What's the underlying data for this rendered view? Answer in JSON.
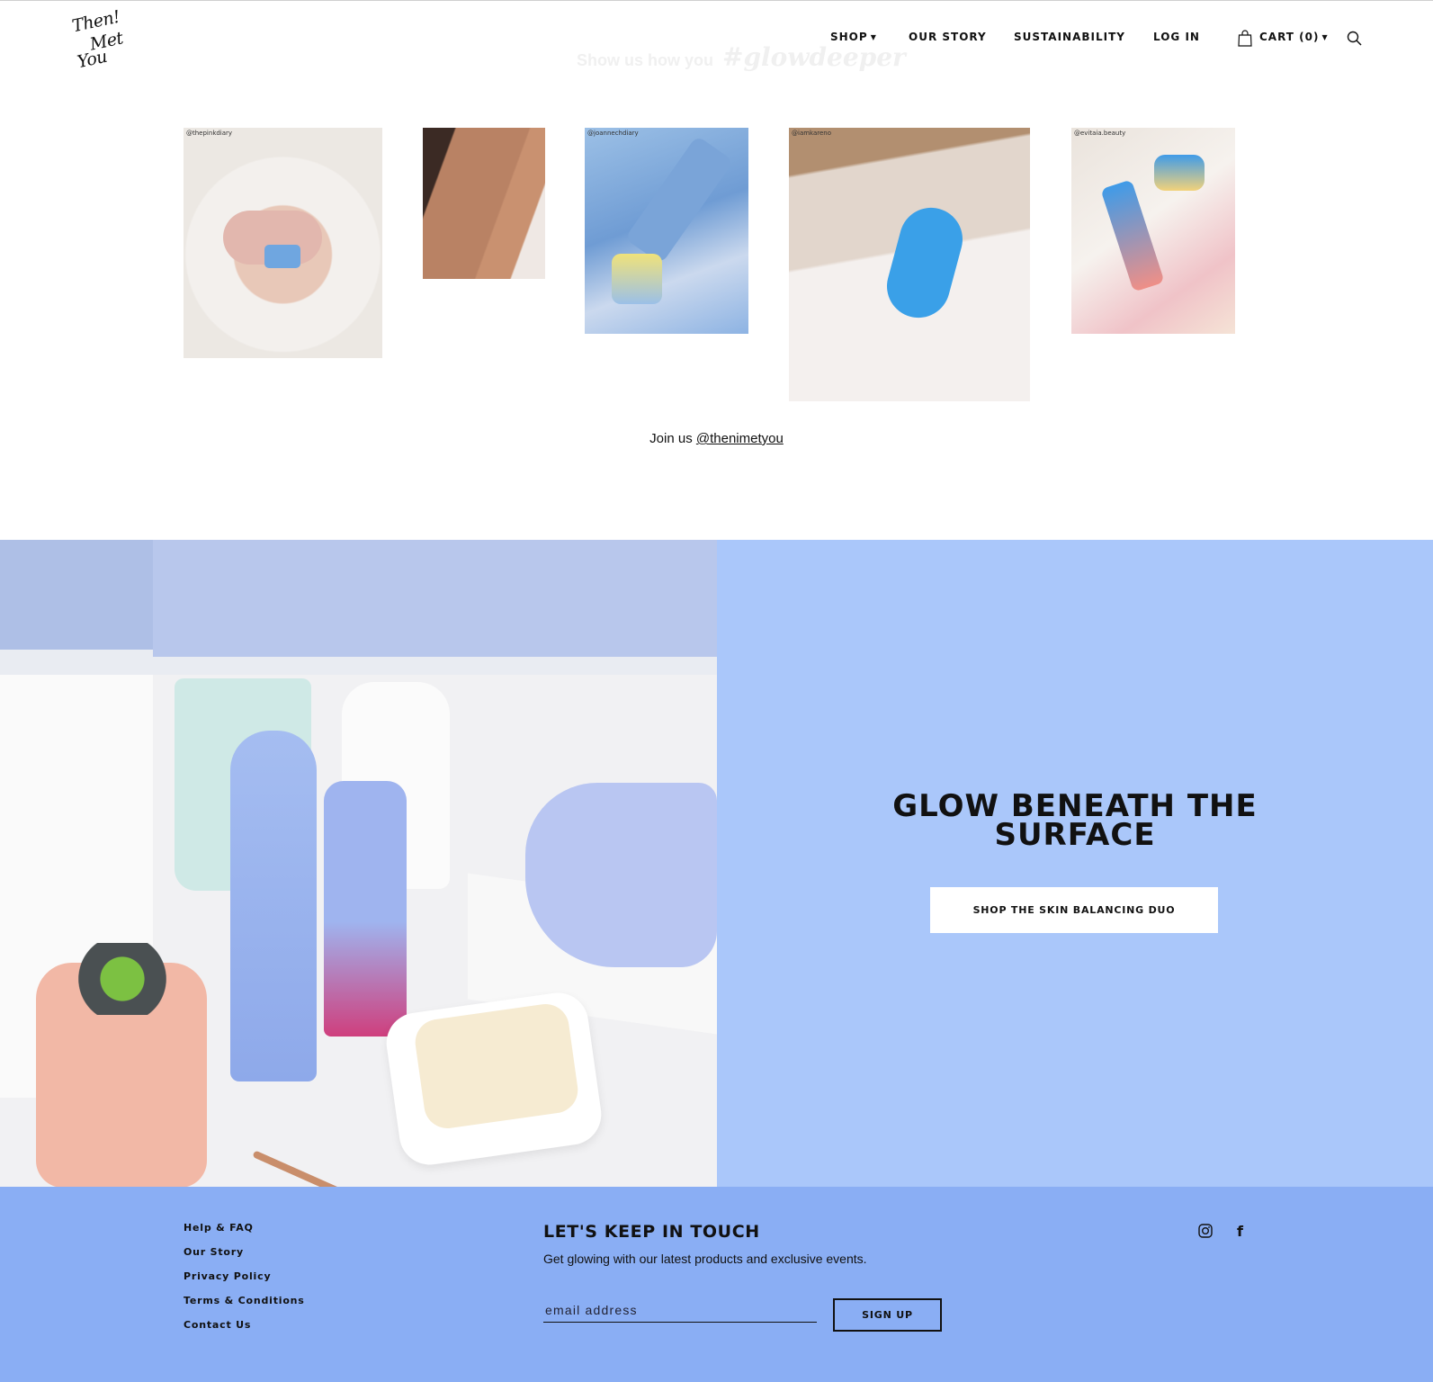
{
  "brand": {
    "logo_lines": [
      "Then!",
      "Met",
      "You"
    ]
  },
  "header": {
    "ghost_prefix": "Show us how you",
    "ghost_hashtag": "#glowdeeper",
    "nav": {
      "shop": "SHOP",
      "our_story": "OUR STORY",
      "sustainability": "SUSTAINABILITY",
      "log_in": "LOG IN",
      "cart": "CART (0)"
    },
    "icons": {
      "cart": "shopping-bag-icon",
      "search": "search-icon",
      "dropdown": "chevron-down-icon"
    }
  },
  "instagram": {
    "posts": [
      {
        "handle": "@thepinkdiary"
      },
      {
        "handle": ""
      },
      {
        "handle": "@joannechdiary"
      },
      {
        "handle": "@iamkareno"
      },
      {
        "handle": "@evitaia.beauty"
      }
    ],
    "join_prefix": "Join us",
    "join_link": "@thenimetyou"
  },
  "hero": {
    "title_line1": "GLOW BENEATH THE",
    "title_line2": "SURFACE",
    "button_label": "SHOP THE SKIN BALANCING DUO",
    "panel_color": "#aac7fa"
  },
  "footer": {
    "links": [
      "Help & FAQ",
      "Our Story",
      "Privacy Policy",
      "Terms & Conditions",
      "Contact Us"
    ],
    "newsletter_title": "LET'S KEEP IN TOUCH",
    "newsletter_sub": "Get glowing with our latest products and exclusive events.",
    "email_placeholder": "email address",
    "signup_label": "SIGN UP",
    "social_icons": [
      "instagram-icon",
      "facebook-icon"
    ],
    "facebook_glyph": "f",
    "background_color": "#8aaef4"
  }
}
